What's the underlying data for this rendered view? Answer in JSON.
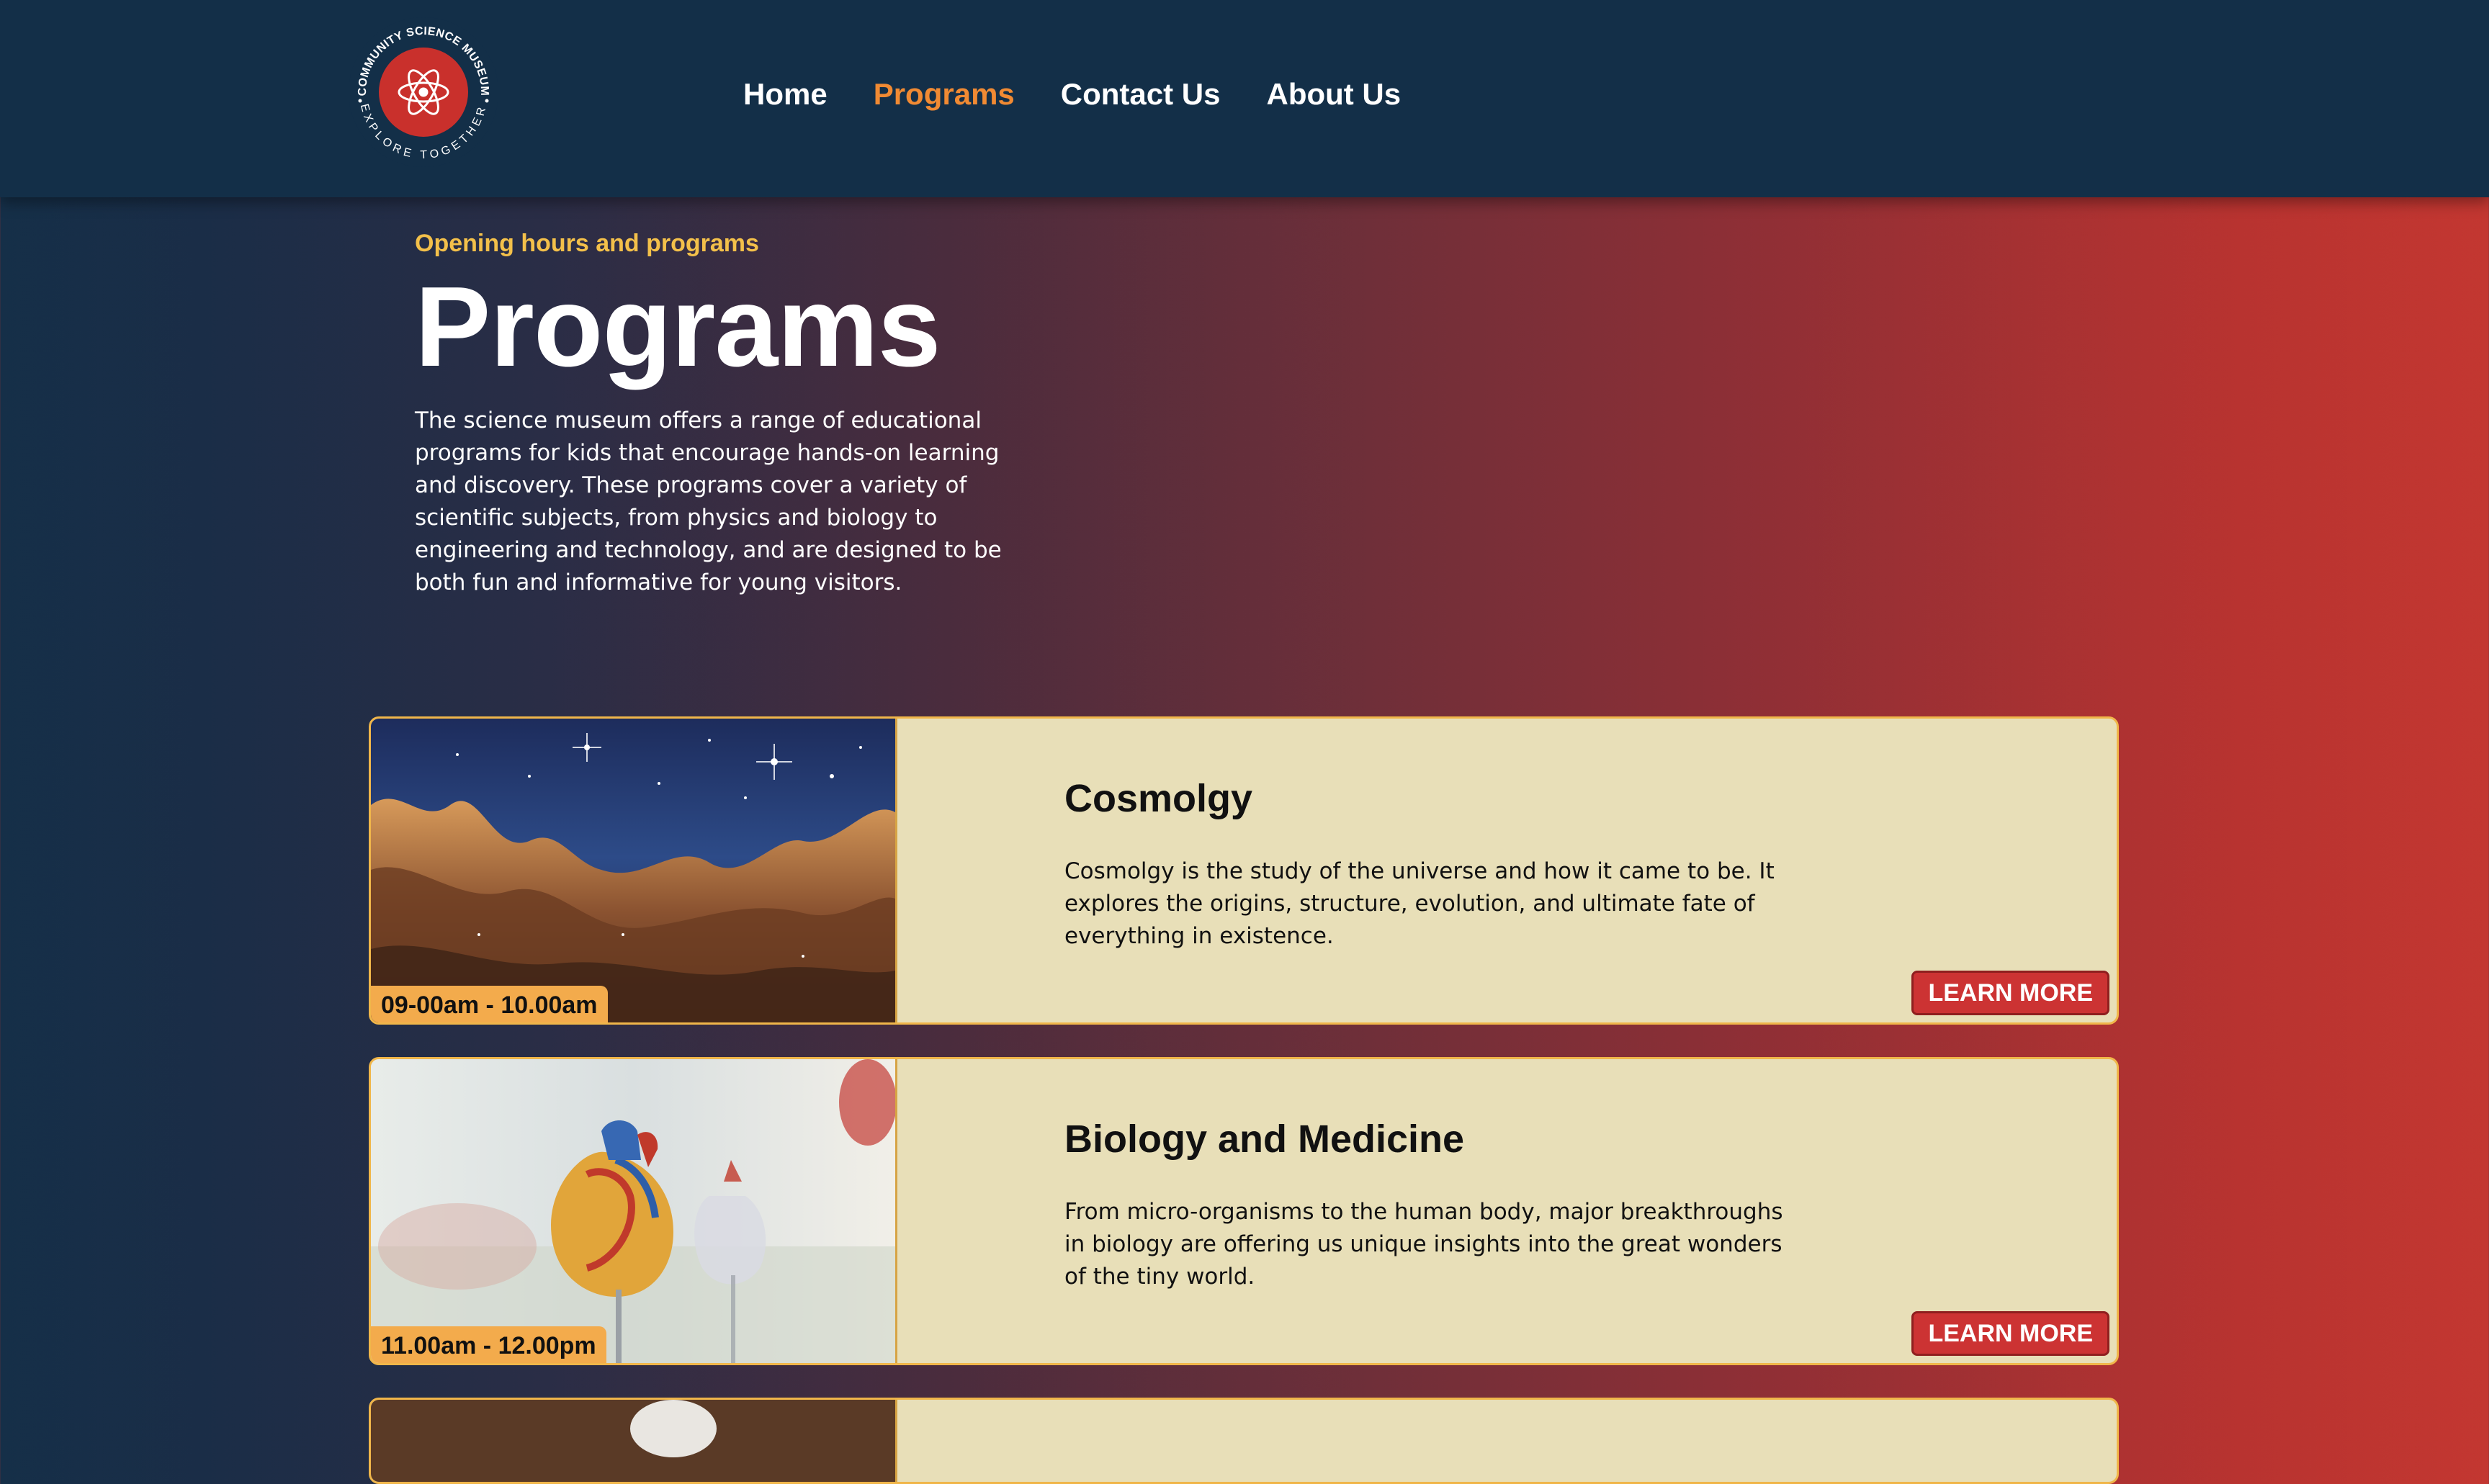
{
  "header": {
    "logo": {
      "ring_text_top": "COMMUNITY SCIENCE MUSEUM",
      "ring_text_bottom": "EXPLORE TOGETHER"
    },
    "nav": [
      {
        "label": "Home",
        "active": false
      },
      {
        "label": "Programs",
        "active": true
      },
      {
        "label": "Contact Us",
        "active": false
      },
      {
        "label": "About Us",
        "active": false
      }
    ]
  },
  "hero": {
    "eyebrow": "Opening hours and programs",
    "title": "Programs",
    "description": "The science museum offers a range of educational programs for kids that encourage hands-on learning and discovery. These programs cover a variety of scientific subjects, from physics and biology to engineering and technology, and are designed to be both fun and informative for young visitors."
  },
  "programs": [
    {
      "time": "09-00am - 10.00am",
      "title": "Cosmolgy",
      "description": "Cosmolgy is the study of the universe and how it came to be. It explores the origins, structure, evolution, and ultimate fate of everything in existence.",
      "button": "LEARN MORE"
    },
    {
      "time": "11.00am - 12.00pm",
      "title": "Biology and Medicine",
      "description": "From micro-organisms to the human body, major breakthroughs in biology are offering us unique insights into the great wonders of the tiny world.",
      "button": "LEARN MORE"
    }
  ],
  "colors": {
    "header_bg": "#132f48",
    "active_nav": "#f08a33",
    "eyebrow": "#f3c04a",
    "card_bg": "#e8dfb8",
    "button_bg": "#cc3333"
  }
}
